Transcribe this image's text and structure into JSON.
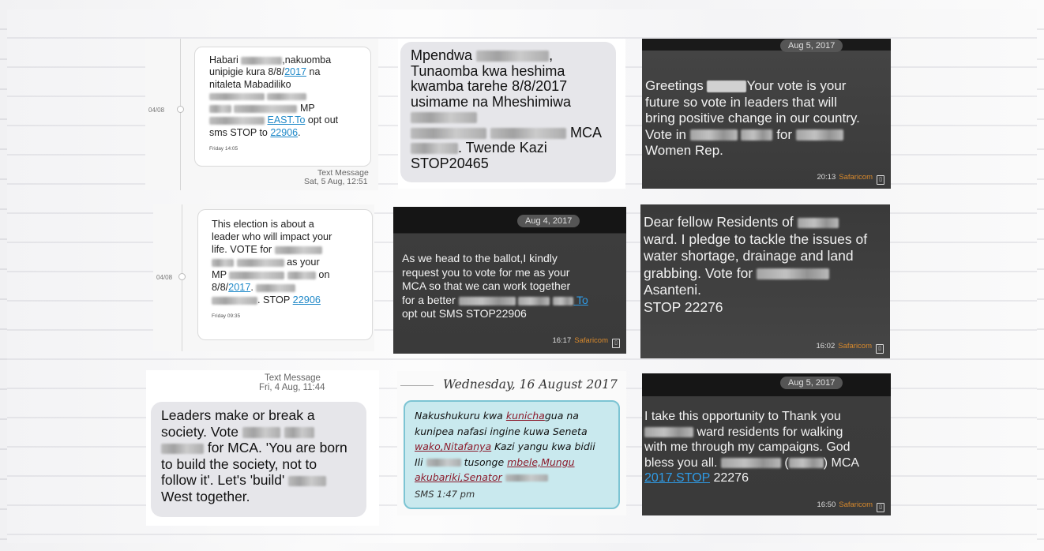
{
  "panel1": {
    "date": "04/08",
    "lines": [
      "Habari",
      ",nakuomba",
      "unipigie kura 8/8/",
      "2017",
      " na",
      "nitaleta Mabadiliko",
      "MP",
      "EAST.To",
      " opt out",
      "sms STOP to ",
      "22906",
      "."
    ],
    "stamp": "Friday 14:05",
    "footer_title": "Text Message",
    "footer_date": "Sat, 5 Aug, 12:51"
  },
  "panel2": {
    "l1a": "Mpendwa",
    "l1b": ",",
    "l2": "Tunaomba kwa heshima",
    "l3": "kwamba tarehe 8/8/2017",
    "l4": "usimame na Mheshimiwa",
    "l6": "MCA",
    "l7": ". Twende Kazi",
    "l8": "STOP20465"
  },
  "panel3": {
    "pill": "Aug 5, 2017",
    "t1a": "Greetings",
    "t1b": "Your vote is your",
    "t2": "future so vote in leaders that will",
    "t3": "bring positive change in our country.",
    "t4a": "Vote in",
    "t4b": "for",
    "t5": "Women Rep.",
    "time": "20:13",
    "carrier": "Safaricom"
  },
  "panel4": {
    "date": "04/08",
    "l1": "This election is about a",
    "l2": "leader who will impact your",
    "l3": "life. VOTE for",
    "l4": "as your",
    "l5a": "MP",
    "l5b": "on",
    "l6a": "8/8/",
    "l6b": "2017",
    "l6c": ".",
    "l7a": ". STOP ",
    "l7b": "22906",
    "stamp": "Friday 09:35"
  },
  "panel5": {
    "pill": "Aug 4, 2017",
    "l1": "As we head to the ballot,I kindly",
    "l2": "request you to vote for me as your",
    "l3": "MCA so that we can work together",
    "l4a": "for a better",
    "l4b": "To",
    "l5": "opt out SMS STOP22906",
    "time": "16:17",
    "carrier": "Safaricom"
  },
  "panel6": {
    "l1": "Dear fellow Residents of",
    "l2": "ward. I pledge to tackle the issues of",
    "l3": "water shortage, drainage and land",
    "l4": "grabbing. Vote for",
    "l5": "Asanteni.",
    "l6": "STOP 22276",
    "time": "16:02",
    "carrier": "Safaricom"
  },
  "panel7": {
    "header_title": "Text Message",
    "header_date": "Fri, 4 Aug, 11:44",
    "l1": "Leaders make or break a",
    "l2": "society. Vote",
    "l3": "for MCA. 'You are born",
    "l4": "to build the society, not to",
    "l5": "follow it'. Let's 'build'",
    "l6": "West together."
  },
  "panel8": {
    "header": "Wednesday, 16 August 2017",
    "l1a": "Nakushukuru kwa ",
    "l1b": "kunicha",
    "l1c": "gua na",
    "l2": "kunipea nafasi ingine kuwa Seneta",
    "l3a": "wako,Nitafanya",
    "l3b": " Kazi yangu kwa bidii",
    "l4a": "Ili",
    "l4b": "tusonge ",
    "l4c": "mbele,Mungu",
    "l5a": "akubariki,Senator",
    "footer": "SMS 1:47 pm"
  },
  "panel9": {
    "pill": "Aug 5, 2017",
    "l1": "I take this opportunity to Thank you",
    "l2": "ward residents for walking",
    "l3": "with me through my campaigns. God",
    "l4a": "bless you all.",
    "l4b": ") MCA",
    "l5a": "2017.STOP",
    "l5b": " 22276",
    "time": "16:50",
    "carrier": "Safaricom"
  }
}
